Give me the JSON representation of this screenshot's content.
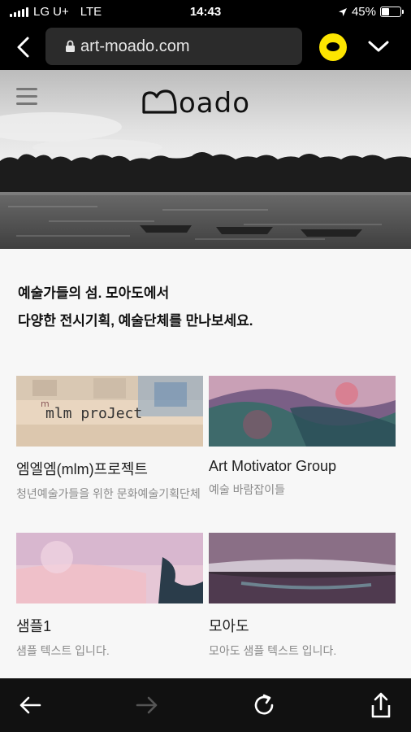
{
  "status": {
    "carrier": "LG U+",
    "network": "LTE",
    "time": "14:43",
    "battery": "45%",
    "battery_level": 0.45
  },
  "browser": {
    "url": "art-moado.com"
  },
  "site": {
    "logo": "moado",
    "intro_line1": "예술가들의 섬. 모아도에서",
    "intro_line2": "다양한 전시기획, 예술단체를 만나보세요."
  },
  "cards": [
    {
      "title": "엠엘엠(mlm)프로젝트",
      "subtitle": "청년예술가들을 위한 문화예술기획단체",
      "thumb_text": "mlm proJect"
    },
    {
      "title": "Art Motivator Group",
      "subtitle": "예술 바람잡이들"
    },
    {
      "title": "샘플1",
      "subtitle": "샘플 텍스트 입니다."
    },
    {
      "title": "모아도",
      "subtitle": "모아도 샘플 텍스트 입니다."
    }
  ],
  "colors": {
    "kakao": "#fde500",
    "bar": "#000000",
    "address_bg": "#2b2b2b"
  }
}
